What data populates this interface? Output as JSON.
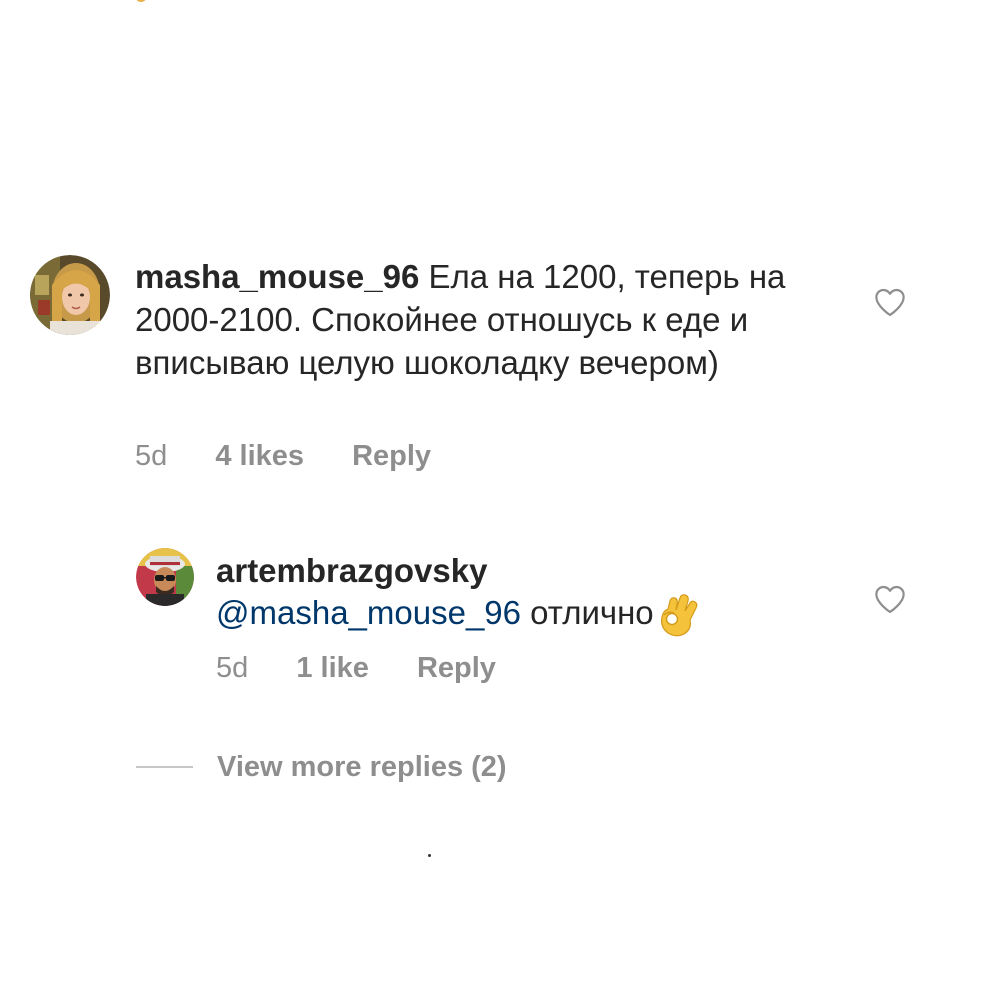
{
  "comment": {
    "username": "masha_mouse_96",
    "text": "Ела на 1200, теперь на 2000-2100. Спокойнее отношусь к еде и вписываю целую шоколадку вечером)",
    "time": "5d",
    "likes": "4 likes",
    "reply_label": "Reply",
    "avatar_icon": "user-avatar-photo",
    "like_icon": "heart-outline-icon"
  },
  "reply": {
    "username": "artembrazgovsky",
    "mention": "@masha_mouse_96",
    "text": " отлично",
    "emoji": "ok-hand-emoji",
    "time": "5d",
    "likes": "1 like",
    "reply_label": "Reply",
    "avatar_icon": "user-avatar-photo",
    "like_icon": "heart-outline-icon"
  },
  "view_more": {
    "label": "View more replies (2)"
  },
  "colors": {
    "text": "#262626",
    "secondary": "#8e8e8e",
    "mention": "#00376b",
    "divider": "#c7c7c7"
  }
}
